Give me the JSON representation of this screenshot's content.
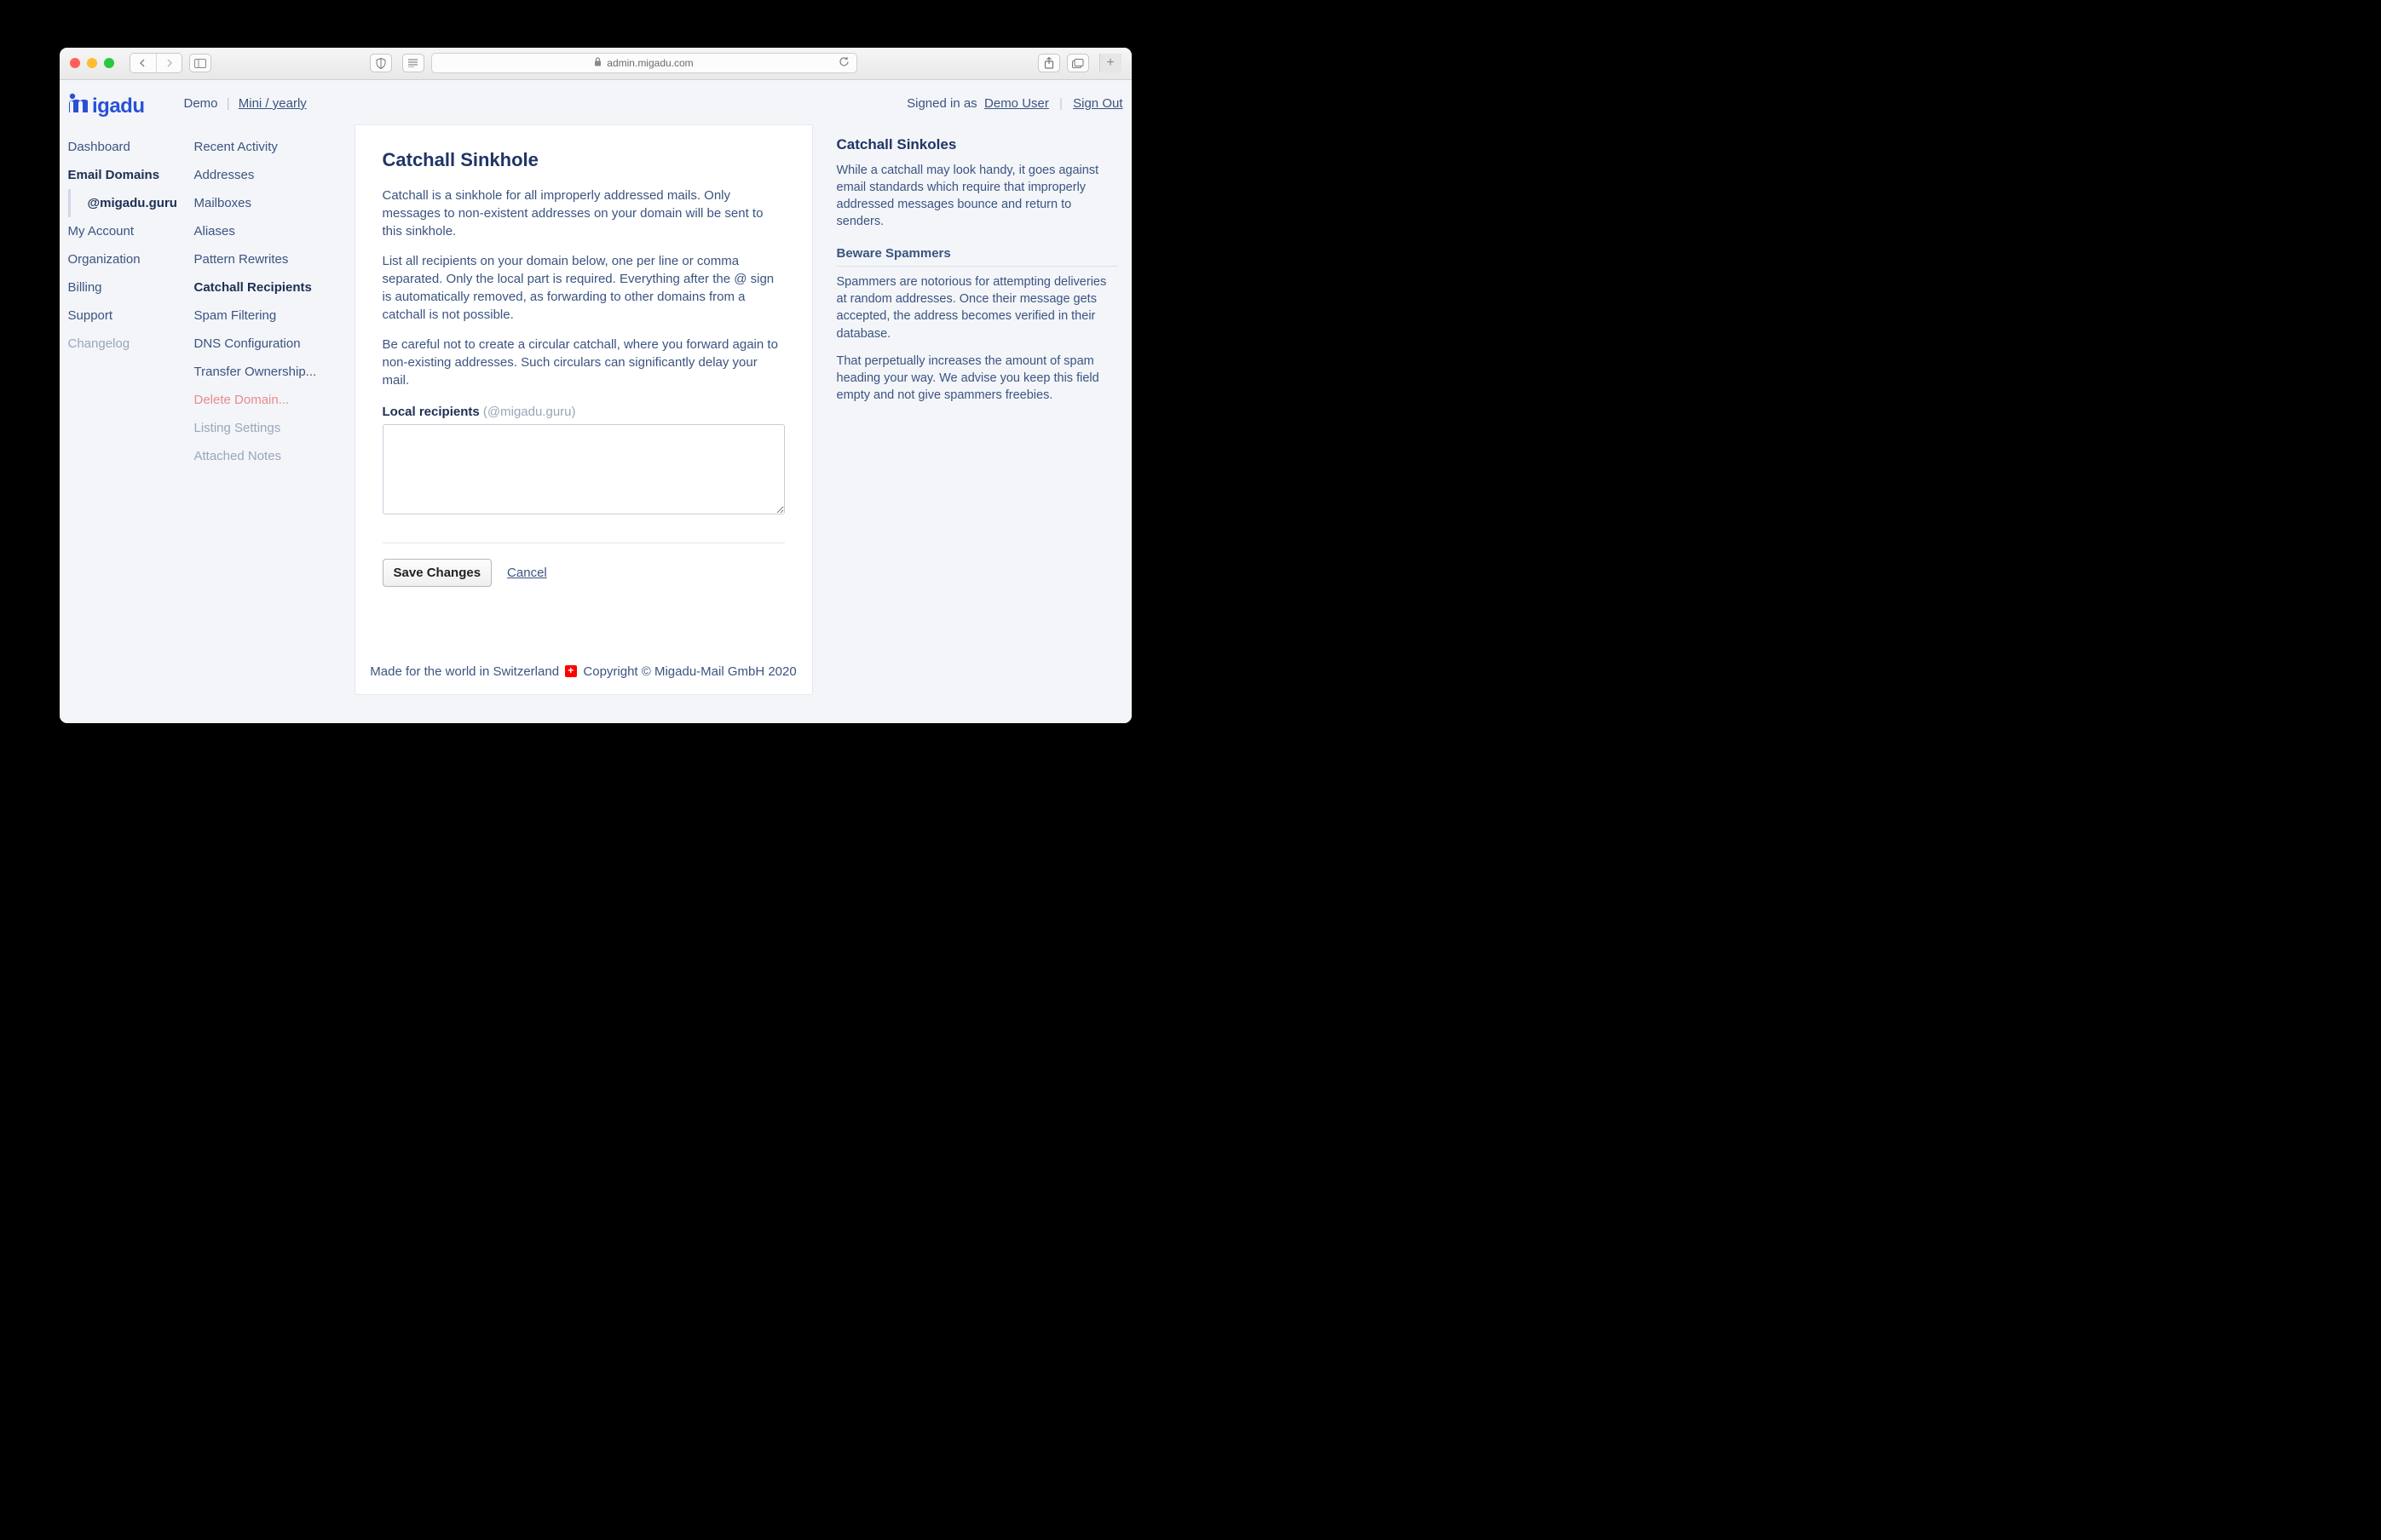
{
  "browser": {
    "url": "admin.migadu.com"
  },
  "header": {
    "logo": "migadu",
    "crumb1": "Demo",
    "crumb2": "Mini / yearly",
    "signed_in_prefix": "Signed in as",
    "user": "Demo User",
    "sign_out": "Sign Out"
  },
  "nav_primary": [
    {
      "label": "Dashboard",
      "active": false
    },
    {
      "label": "Email Domains",
      "active": true
    },
    {
      "label": "@migadu.guru",
      "sub": true
    },
    {
      "label": "My Account"
    },
    {
      "label": "Organization"
    },
    {
      "label": "Billing"
    },
    {
      "label": "Support"
    },
    {
      "label": "Changelog",
      "muted": true
    }
  ],
  "nav_secondary": [
    {
      "label": "Recent Activity"
    },
    {
      "label": "Addresses"
    },
    {
      "label": "Mailboxes"
    },
    {
      "label": "Aliases"
    },
    {
      "label": "Pattern Rewrites"
    },
    {
      "label": "Catchall Recipients",
      "active": true
    },
    {
      "label": "Spam Filtering"
    },
    {
      "label": "DNS Configuration"
    },
    {
      "label": "Transfer Ownership..."
    },
    {
      "label": "Delete Domain...",
      "danger": true
    },
    {
      "label": "Listing Settings",
      "muted": true
    },
    {
      "label": "Attached Notes",
      "muted": true
    }
  ],
  "main": {
    "title": "Catchall Sinkhole",
    "p1": "Catchall is a sinkhole for all improperly addressed mails. Only messages to non-existent addresses on your domain will be sent to this sinkhole.",
    "p2": "List all recipients on your domain below, one per line or comma separated. Only the local part is required. Everything after the @ sign is automatically removed, as forwarding to other domains from a catchall is not possible.",
    "p3": "Be careful not to create a circular catchall, where you forward again to non-existing addresses. Such circulars can significantly delay your mail.",
    "label": "Local recipients",
    "label_hint": "(@migadu.guru)",
    "save": "Save Changes",
    "cancel": "Cancel",
    "footer_left": "Made for the world in Switzerland",
    "footer_right": "Copyright © Migadu-Mail GmbH 2020"
  },
  "aside": {
    "h1": "Catchall Sinkoles",
    "p1": "While a catchall may look handy, it goes against email standards which require that improperly addressed messages bounce and return to senders.",
    "h2": "Beware Spammers",
    "p2": "Spammers are notorious for attempting deliveries at random addresses. Once their message gets accepted, the address becomes verified in their database.",
    "p3": "That perpetually increases the amount of spam heading your way. We advise you keep this field empty and not give spammers freebies."
  }
}
